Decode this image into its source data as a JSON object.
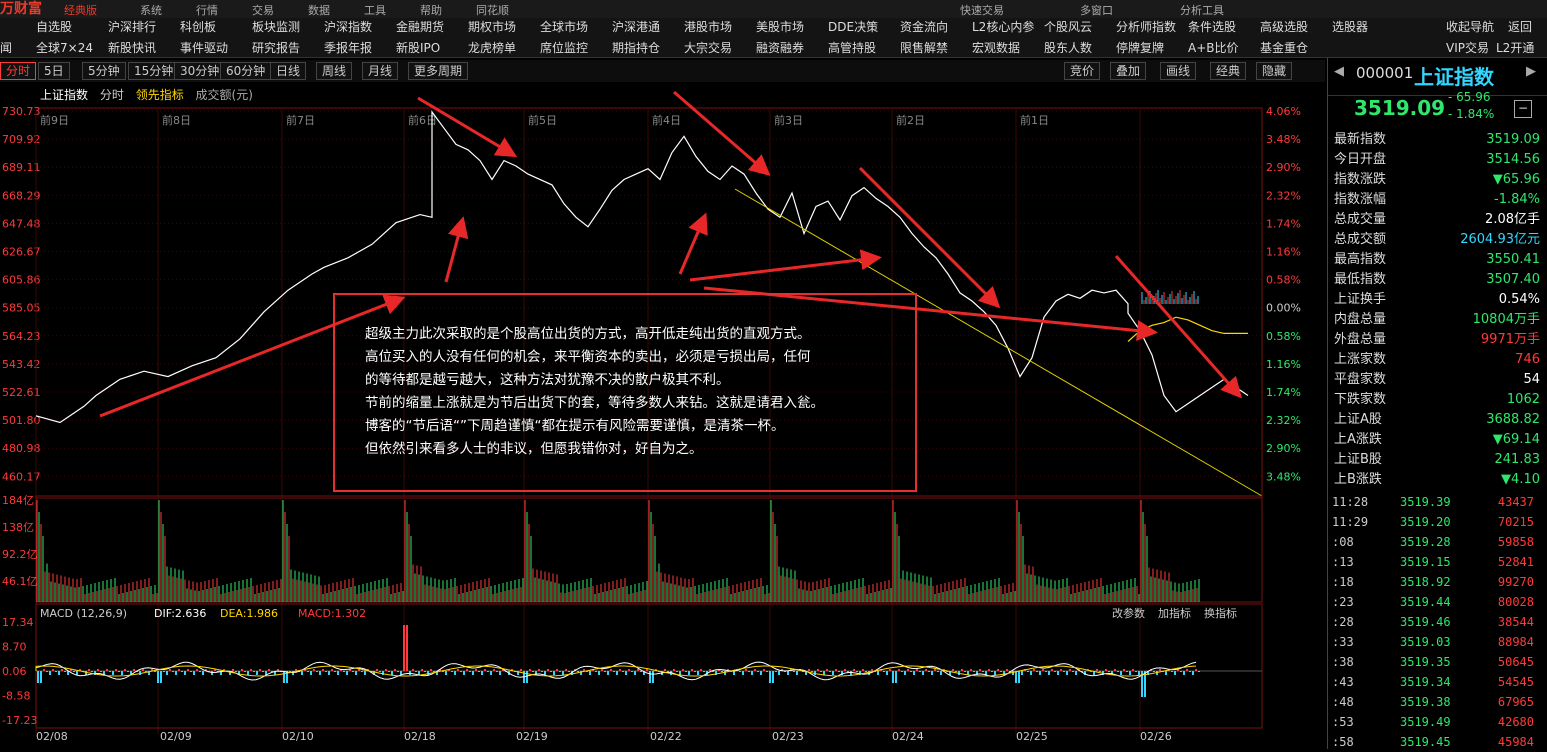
{
  "brand": {
    "name": "万财富",
    "edition": "经典版"
  },
  "topbar_items": [
    "系统",
    "行情",
    "交易",
    "数据",
    "工具",
    "帮助",
    "同花顺",
    "快速交易",
    "多窗口",
    "分析工具"
  ],
  "menu": {
    "row1": [
      "自选股",
      "沪深排行",
      "科创板",
      "板块监测",
      "沪深指数",
      "金融期货",
      "期权市场",
      "全球市场",
      "沪深港通",
      "港股市场",
      "美股市场",
      "DDE决策",
      "资金流向",
      "L2核心内参",
      "个股风云",
      "分析师指数",
      "条件选股",
      "高级选股",
      "选股器"
    ],
    "row2": [
      "全球7×24",
      "新股快讯",
      "事件驱动",
      "研究报告",
      "季报年报",
      "新股IPO",
      "龙虎榜单",
      "席位监控",
      "期指持仓",
      "大宗交易",
      "融资融券",
      "高管持股",
      "限售解禁",
      "宏观数据",
      "股东人数",
      "停牌复牌",
      "A+B比价",
      "基金重仓"
    ],
    "row1_right": [
      "收起导航",
      "返回"
    ],
    "row2_right": [
      "VIP交易",
      "L2开通"
    ],
    "left_cut": "闻"
  },
  "periods": [
    "分时",
    "5日",
    "5分钟",
    "15分钟",
    "30分钟",
    "60分钟",
    "日线",
    "周线",
    "月线",
    "更多周期"
  ],
  "right_tools": [
    "竞价",
    "叠加",
    "画线",
    "经典",
    "隐藏"
  ],
  "chart_header": {
    "index": "上证指数",
    "mode": "分时",
    "indicator": "领先指标",
    "vol": "成交额(元)"
  },
  "stock": {
    "code": "000001",
    "name": "上证指数",
    "price": "3519.09",
    "change": "- 65.96",
    "pct": "- 1.84%"
  },
  "quote": [
    {
      "label": "最新指数",
      "value": "3519.09",
      "color": "green"
    },
    {
      "label": "今日开盘",
      "value": "3514.56",
      "color": "green"
    },
    {
      "label": "指数涨跌",
      "value": "▼65.96",
      "color": "green"
    },
    {
      "label": "指数涨幅",
      "value": "-1.84%",
      "color": "green"
    },
    {
      "label": "总成交量",
      "value": "2.08亿手",
      "color": "white"
    },
    {
      "label": "总成交额",
      "value": "2604.93亿元",
      "color": "cyan"
    },
    {
      "label": "最高指数",
      "value": "3550.41",
      "color": "green"
    },
    {
      "label": "最低指数",
      "value": "3507.40",
      "color": "green"
    },
    {
      "label": "上证换手",
      "value": "0.54%",
      "color": "white"
    },
    {
      "label": "内盘总量",
      "value": "10804万手",
      "color": "green"
    },
    {
      "label": "外盘总量",
      "value": "9971万手",
      "color": "red"
    },
    {
      "label": "上涨家数",
      "value": "746",
      "color": "red"
    },
    {
      "label": "平盘家数",
      "value": "54",
      "color": "white"
    },
    {
      "label": "下跌家数",
      "value": "1062",
      "color": "green"
    },
    {
      "label": "上证A股",
      "value": "3688.82",
      "color": "green"
    },
    {
      "label": "上A涨跌",
      "value": "▼69.14",
      "color": "green"
    },
    {
      "label": "上证B股",
      "value": "241.83",
      "color": "green"
    },
    {
      "label": "上B涨跌",
      "value": "▼4.10",
      "color": "green"
    }
  ],
  "ticks": [
    {
      "time": "11:28",
      "price": "3519.39",
      "vol": "43437"
    },
    {
      "time": "11:29",
      "price": "3519.20",
      "vol": "70215"
    },
    {
      "time": ":08",
      "price": "3519.28",
      "vol": "59858"
    },
    {
      "time": ":13",
      "price": "3519.15",
      "vol": "52841"
    },
    {
      "time": ":18",
      "price": "3518.92",
      "vol": "99270"
    },
    {
      "time": ":23",
      "price": "3519.44",
      "vol": "80028"
    },
    {
      "time": ":28",
      "price": "3519.46",
      "vol": "38544"
    },
    {
      "time": ":33",
      "price": "3519.03",
      "vol": "88984"
    },
    {
      "time": ":38",
      "price": "3519.35",
      "vol": "50645"
    },
    {
      "time": ":43",
      "price": "3519.34",
      "vol": "54545"
    },
    {
      "time": ":48",
      "price": "3519.38",
      "vol": "67965"
    },
    {
      "time": ":53",
      "price": "3519.49",
      "vol": "42680"
    },
    {
      "time": ":58",
      "price": "3519.45",
      "vol": "45984"
    }
  ],
  "annotation": [
    "超级主力此次采取的是个股高位出货的方式，高开低走纯出货的直观方式。",
    "高位买入的人没有任何的机会，来平衡资本的卖出，必须是亏损出局，任何",
    "的等待都是越亏越大，这种方法对犹豫不决的散户极其不利。",
    "节前的缩量上涨就是为节后出货下的套，等待多数人来钻。这就是请君入瓮。",
    "博客的“节后语“”下周趋谨慎“都在提示有风险需要谨慎，是清茶一杯。",
    "但依然引来看多人士的非议，但愿我错你对，好自为之。"
  ],
  "chart_data": {
    "type": "line",
    "title": "上证指数",
    "y_left_ticks": [
      "730.73",
      "709.92",
      "689.11",
      "668.29",
      "647.48",
      "626.67",
      "605.86",
      "585.05",
      "564.23",
      "543.42",
      "522.61",
      "501.80",
      "480.98",
      "460.17"
    ],
    "y_right_ticks": [
      "4.06%",
      "3.48%",
      "2.90%",
      "2.32%",
      "1.74%",
      "1.16%",
      "0.58%",
      "0.00%",
      "0.58%",
      "1.16%",
      "1.74%",
      "2.32%",
      "2.90%",
      "3.48%"
    ],
    "day_labels": [
      "前9日",
      "前8日",
      "前7日",
      "前6日",
      "前5日",
      "前4日",
      "前3日",
      "前2日",
      "前1日"
    ],
    "x_dates": [
      "02/08",
      "02/09",
      "02/10",
      "02/18",
      "02/19",
      "02/22",
      "02/23",
      "02/24",
      "02/25",
      "02/26"
    ],
    "price_path": [
      [
        0,
        505
      ],
      [
        4,
        500
      ],
      [
        8,
        512
      ],
      [
        10,
        520
      ],
      [
        14,
        532
      ],
      [
        18,
        538
      ],
      [
        22,
        534
      ],
      [
        26,
        542
      ],
      [
        30,
        548
      ],
      [
        34,
        562
      ],
      [
        38,
        582
      ],
      [
        42,
        598
      ],
      [
        46,
        610
      ],
      [
        48,
        615
      ],
      [
        52,
        622
      ],
      [
        56,
        632
      ],
      [
        60,
        648
      ],
      [
        64,
        654
      ],
      [
        66,
        652
      ],
      [
        66,
        730
      ],
      [
        68,
        718
      ],
      [
        70,
        706
      ],
      [
        72,
        702
      ],
      [
        74,
        694
      ],
      [
        76,
        680
      ],
      [
        78,
        694
      ],
      [
        80,
        690
      ],
      [
        82,
        684
      ],
      [
        86,
        676
      ],
      [
        88,
        662
      ],
      [
        90,
        652
      ],
      [
        92,
        645
      ],
      [
        94,
        658
      ],
      [
        96,
        672
      ],
      [
        98,
        680
      ],
      [
        100,
        684
      ],
      [
        102,
        688
      ],
      [
        104,
        680
      ],
      [
        106,
        700
      ],
      [
        108,
        712
      ],
      [
        110,
        697
      ],
      [
        112,
        686
      ],
      [
        114,
        680
      ],
      [
        116,
        690
      ],
      [
        118,
        684
      ],
      [
        120,
        670
      ],
      [
        122,
        658
      ],
      [
        124,
        652
      ],
      [
        126,
        670
      ],
      [
        128,
        640
      ],
      [
        130,
        660
      ],
      [
        132,
        664
      ],
      [
        134,
        650
      ],
      [
        136,
        668
      ],
      [
        138,
        674
      ],
      [
        140,
        666
      ],
      [
        142,
        660
      ],
      [
        144,
        652
      ],
      [
        146,
        640
      ],
      [
        148,
        630
      ],
      [
        150,
        622
      ],
      [
        152,
        610
      ],
      [
        154,
        596
      ],
      [
        156,
        590
      ],
      [
        158,
        582
      ],
      [
        160,
        572
      ],
      [
        162,
        555
      ],
      [
        164,
        534
      ],
      [
        166,
        548
      ],
      [
        168,
        578
      ],
      [
        170,
        590
      ],
      [
        172,
        595
      ],
      [
        174,
        592
      ],
      [
        176,
        598
      ],
      [
        178,
        596
      ],
      [
        180,
        598
      ],
      [
        182,
        588
      ],
      [
        182,
        581
      ],
      [
        184,
        568
      ],
      [
        186,
        550
      ],
      [
        188,
        520
      ],
      [
        190,
        508
      ],
      [
        192,
        514
      ],
      [
        194,
        520
      ],
      [
        196,
        526
      ],
      [
        198,
        532
      ],
      [
        200,
        526
      ],
      [
        202,
        520
      ]
    ],
    "avg_path": [
      [
        182,
        560
      ],
      [
        184,
        568
      ],
      [
        186,
        572
      ],
      [
        188,
        574
      ],
      [
        190,
        578
      ],
      [
        192,
        576
      ],
      [
        194,
        572
      ],
      [
        196,
        568
      ],
      [
        198,
        566
      ],
      [
        202,
        566
      ]
    ],
    "volume_left_ticks": [
      "184亿",
      "138亿",
      "92.2亿",
      "46.1亿"
    ],
    "macd": {
      "name": "MACD (12,26,9)",
      "dif": "DIF:2.636",
      "dea": "DEA:1.986",
      "macd": "MACD:1.302",
      "y_ticks": [
        "17.34",
        "8.70",
        "0.06",
        "-8.58",
        "-17.23"
      ],
      "tools": [
        "改参数",
        "加指标",
        "换指标"
      ]
    }
  }
}
